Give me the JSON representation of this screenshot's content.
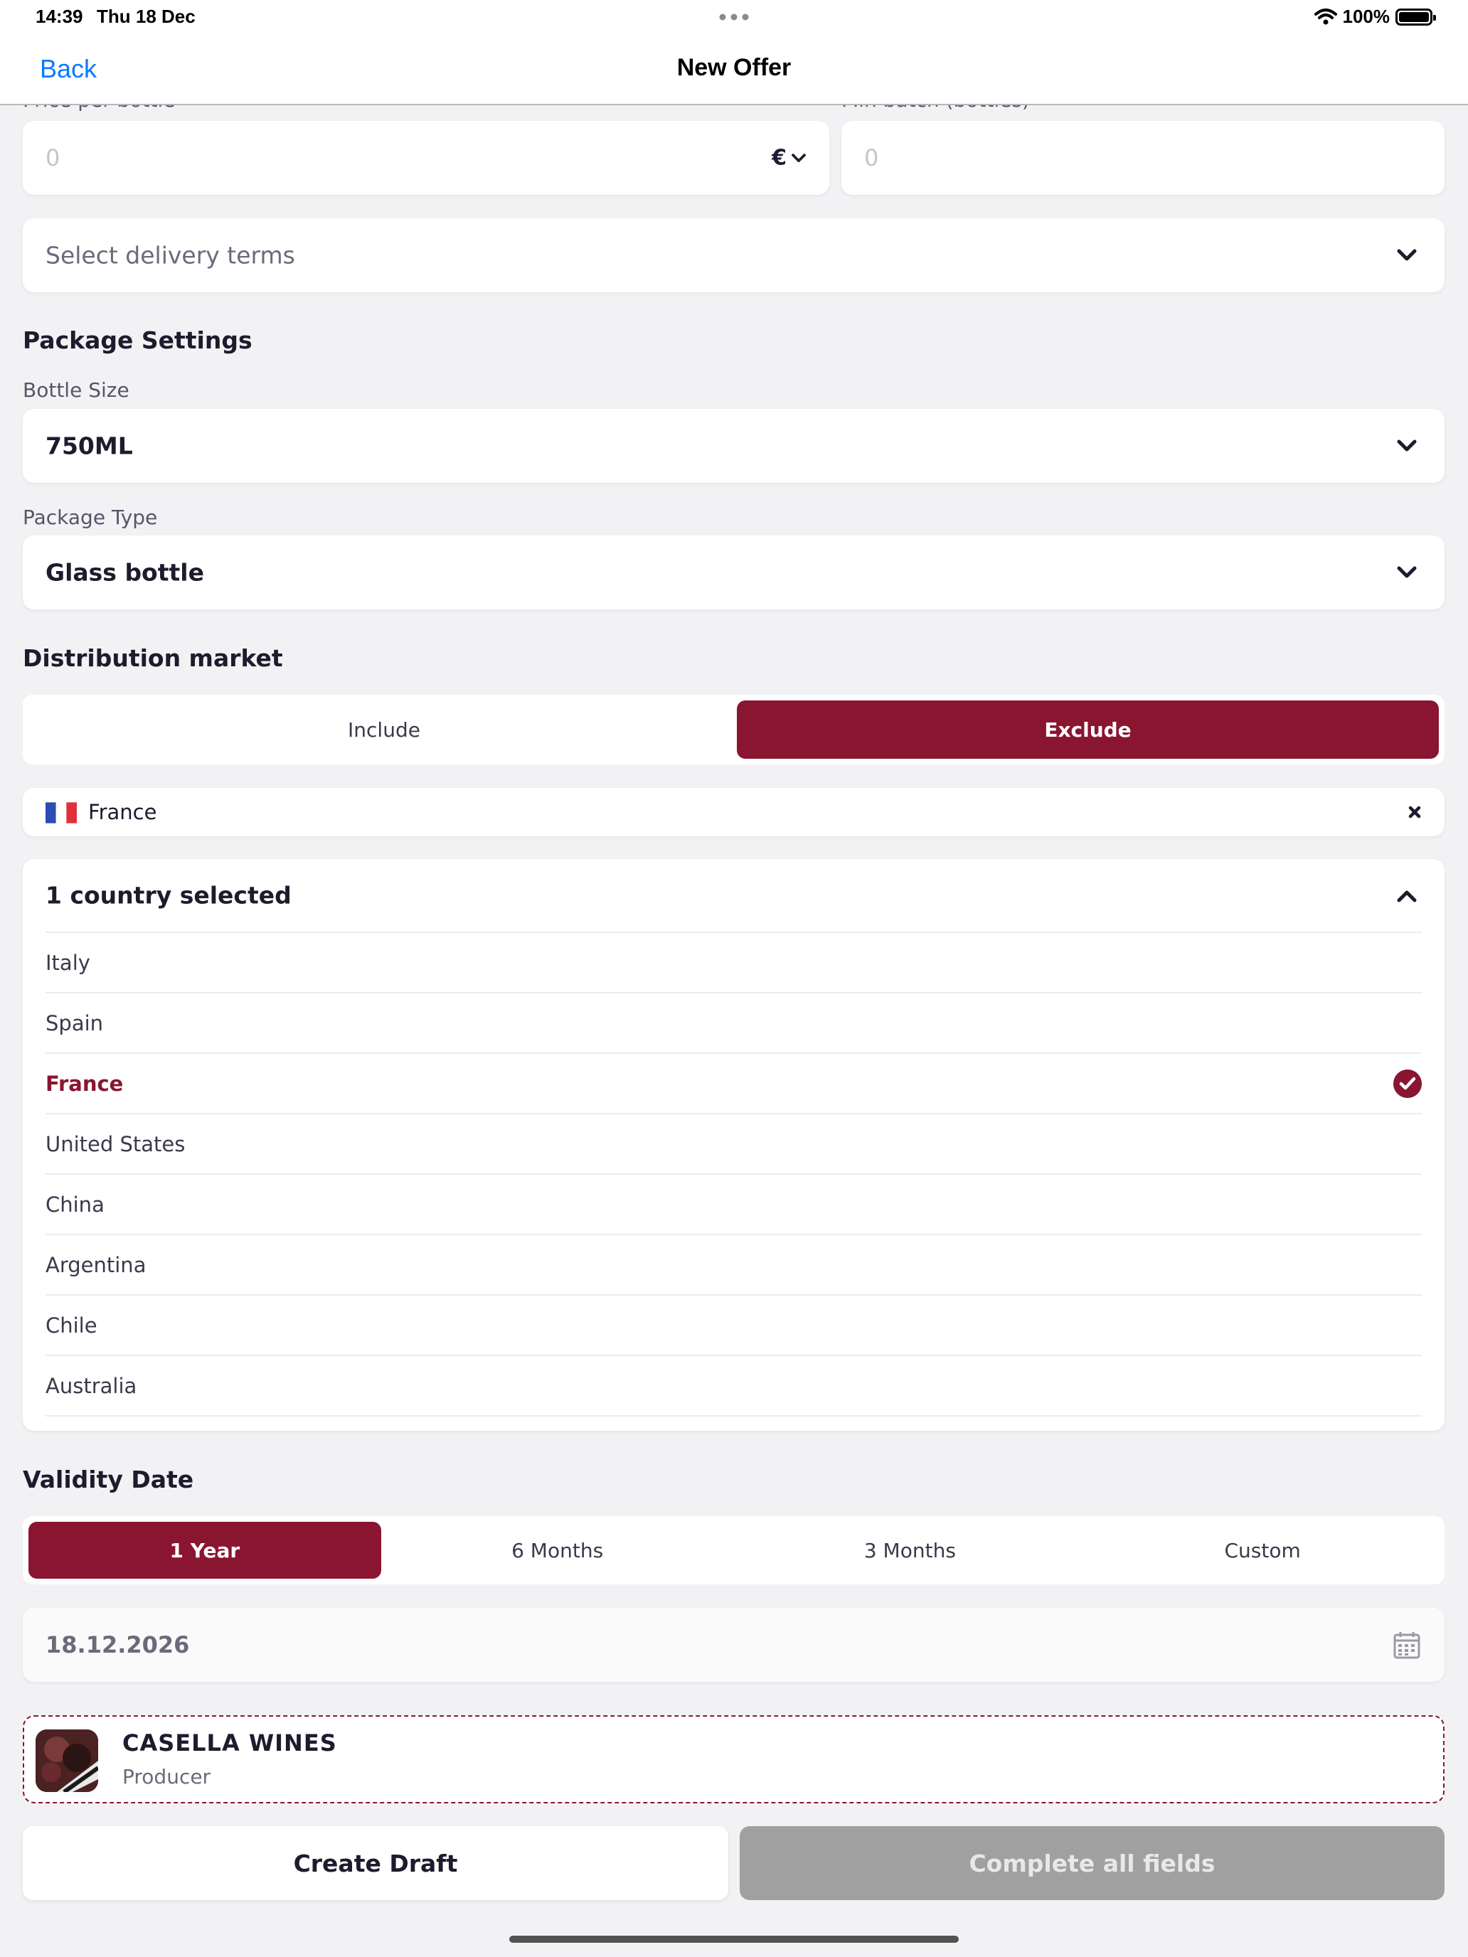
{
  "status_bar": {
    "time": "14:39",
    "date": "Thu 18 Dec",
    "battery": "100%"
  },
  "nav": {
    "back": "Back",
    "title": "New Offer"
  },
  "price": {
    "label": "Price per bottle",
    "placeholder": "0",
    "currency": "€"
  },
  "min_batch": {
    "label": "Min batch (bottles)",
    "placeholder": "0"
  },
  "delivery": {
    "placeholder": "Select delivery terms"
  },
  "package_settings": {
    "title": "Package Settings",
    "bottle_size_label": "Bottle Size",
    "bottle_size_value": "750ML",
    "package_type_label": "Package Type",
    "package_type_value": "Glass bottle"
  },
  "distribution": {
    "title": "Distribution market",
    "include": "Include",
    "exclude": "Exclude",
    "active": "Exclude",
    "chip": {
      "flag": "france-flag-icon",
      "label": "France"
    },
    "selected_summary": "1 country selected",
    "countries": [
      {
        "name": "Italy",
        "selected": false
      },
      {
        "name": "Spain",
        "selected": false
      },
      {
        "name": "France",
        "selected": true
      },
      {
        "name": "United States",
        "selected": false
      },
      {
        "name": "China",
        "selected": false
      },
      {
        "name": "Argentina",
        "selected": false
      },
      {
        "name": "Chile",
        "selected": false
      },
      {
        "name": "Australia",
        "selected": false
      }
    ]
  },
  "validity": {
    "title": "Validity Date",
    "options": [
      "1 Year",
      "6 Months",
      "3 Months",
      "Custom"
    ],
    "active": "1 Year",
    "date": "18.12.2026"
  },
  "producer": {
    "name": "CASELLA WINES",
    "role": "Producer"
  },
  "actions": {
    "draft": "Create Draft",
    "submit": "Complete all fields"
  },
  "colors": {
    "accent": "#8a1530",
    "link": "#0a7aff",
    "disabled": "#a0a0a0"
  }
}
